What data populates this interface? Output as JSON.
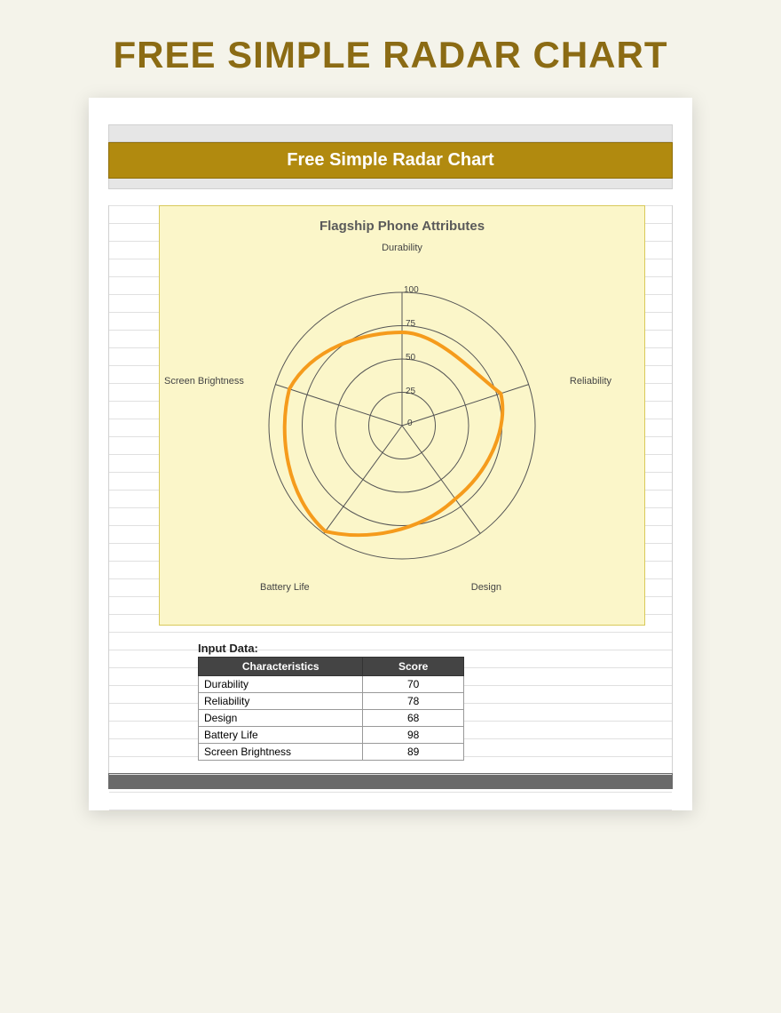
{
  "page": {
    "title": "FREE SIMPLE RADAR CHART"
  },
  "sheet": {
    "title": "Free Simple Radar Chart"
  },
  "chart": {
    "title": "Flagship Phone Attributes",
    "ticks": [
      "0",
      "25",
      "50",
      "75",
      "100"
    ]
  },
  "chart_data": {
    "type": "radar",
    "title": "Flagship Phone Attributes",
    "categories": [
      "Durability",
      "Reliability",
      "Design",
      "Battery Life",
      "Screen Brightness"
    ],
    "values": [
      70,
      78,
      68,
      98,
      89
    ],
    "ticks": [
      0,
      25,
      50,
      75,
      100
    ],
    "max": 100,
    "series_color": "#f59b1c"
  },
  "input": {
    "heading": "Input Data:",
    "col_characteristics": "Characteristics",
    "col_score": "Score",
    "rows": [
      {
        "label": "Durability",
        "score": "70"
      },
      {
        "label": "Reliability",
        "score": "78"
      },
      {
        "label": "Design",
        "score": "68"
      },
      {
        "label": "Battery Life",
        "score": "98"
      },
      {
        "label": "Screen Brightness",
        "score": "89"
      }
    ]
  }
}
